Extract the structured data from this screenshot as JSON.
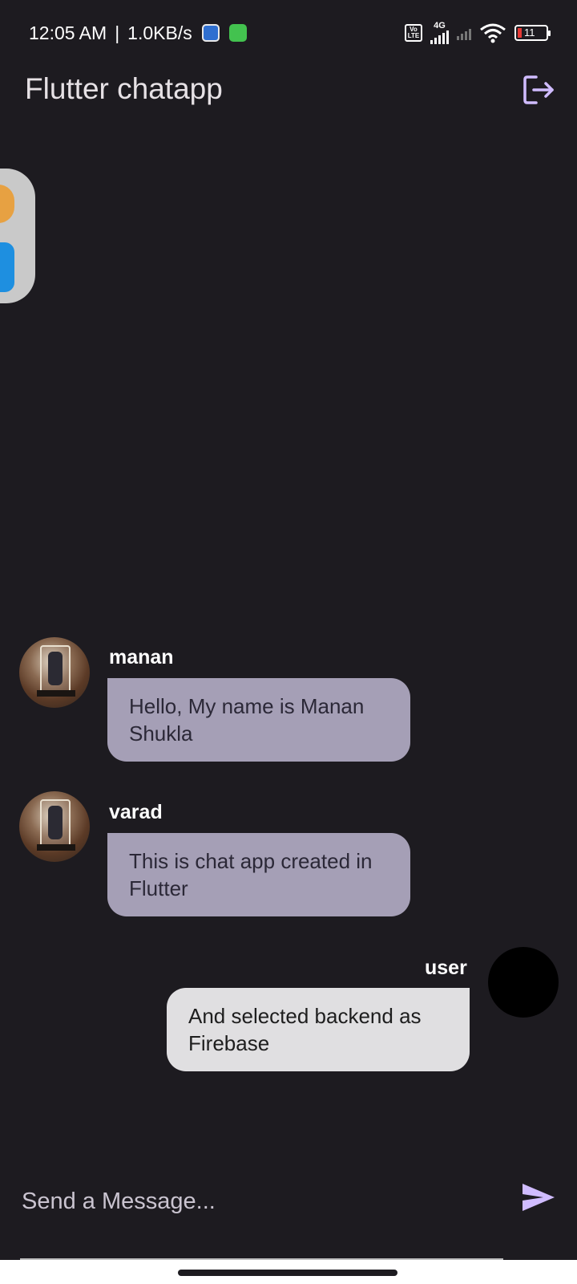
{
  "status_bar": {
    "time": "12:05 AM",
    "separator": "|",
    "net_speed": "1.0KB/s",
    "volte": "Vo LTE",
    "network": "4G",
    "battery": "11"
  },
  "app_bar": {
    "title": "Flutter chatapp",
    "logout_icon": "logout-icon"
  },
  "messages": [
    {
      "sender": "manan",
      "text": "Hello, My name is Manan Shukla",
      "direction": "received"
    },
    {
      "sender": "varad",
      "text": "This is chat app created in Flutter",
      "direction": "received"
    },
    {
      "sender": "user",
      "text": "And selected backend as Firebase",
      "direction": "sent"
    }
  ],
  "composer": {
    "placeholder": "Send a Message...",
    "value": "",
    "send_icon": "send-icon"
  },
  "colors": {
    "background": "#1d1b20",
    "accent": "#d0bcff",
    "received_bubble": "#a59fb6",
    "sent_bubble": "#e0dfe1"
  }
}
